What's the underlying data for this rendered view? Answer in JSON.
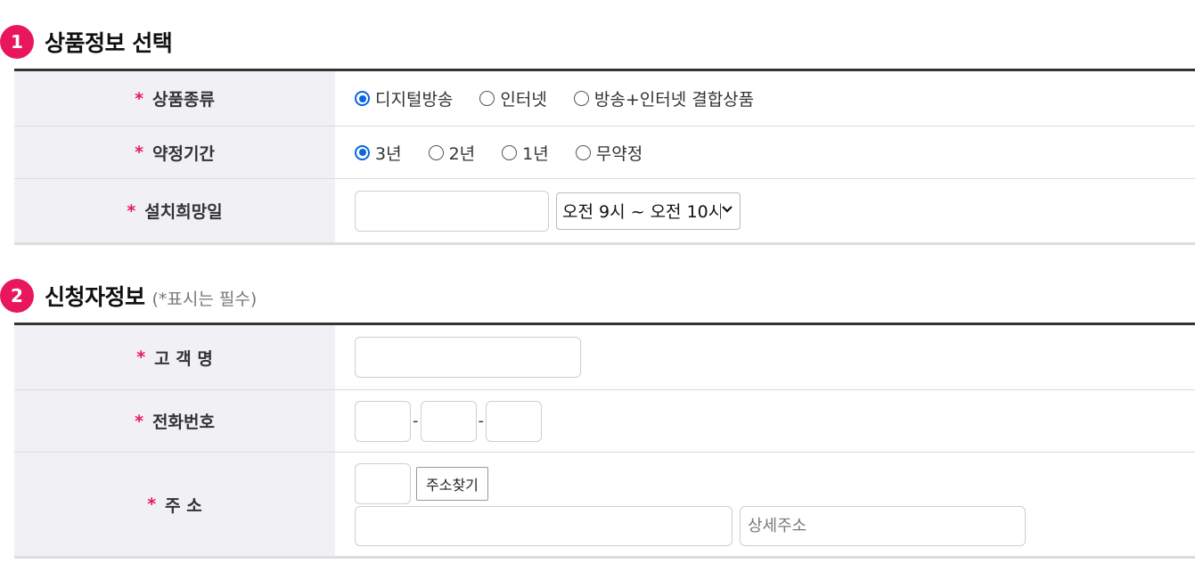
{
  "section1": {
    "badge": "1",
    "title": "상품정보 선택"
  },
  "product_form": {
    "product_type": {
      "label": "상품종류",
      "options": [
        "디지털방송",
        "인터넷",
        "방송+인터넷 결합상품"
      ],
      "selected_index": 0
    },
    "contract_period": {
      "label": "약정기간",
      "options": [
        "3년",
        "2년",
        "1년",
        "무약정"
      ],
      "selected_index": 0
    },
    "install_date": {
      "label": "설치희망일",
      "date_value": "",
      "time_select_value": "오전 9시 ~ 오전 10시"
    }
  },
  "section2": {
    "badge": "2",
    "title": "신청자정보",
    "note": "(*표시는 필수)"
  },
  "applicant_form": {
    "name": {
      "label": "고 객 명",
      "value": ""
    },
    "phone": {
      "label": "전화번호",
      "part1": "",
      "part2": "",
      "part3": "",
      "separator": "-"
    },
    "address": {
      "label": "주 소",
      "zipcode": "",
      "search_button": "주소찾기",
      "address_value": "",
      "detail_placeholder": "상세주소"
    }
  },
  "required_mark": "*",
  "colors": {
    "accent": "#e8175d",
    "radio_checked": "#0a66e0",
    "label_bg": "#f1f1f5"
  }
}
